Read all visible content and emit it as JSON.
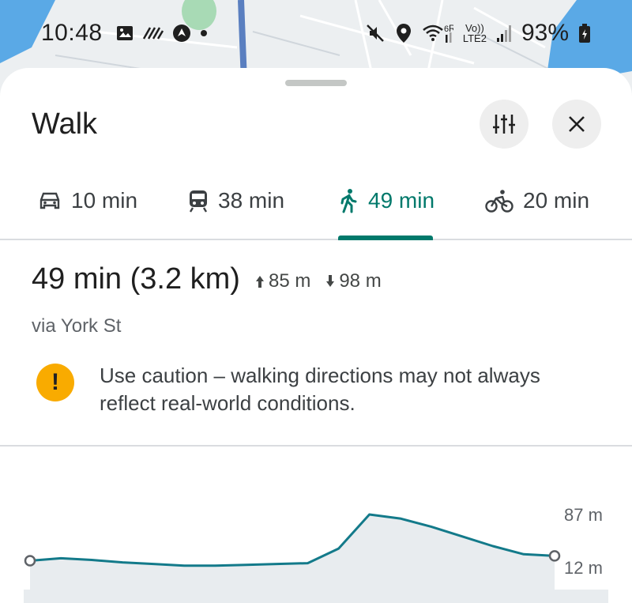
{
  "status_bar": {
    "time": "10:48",
    "battery": "93%",
    "left_icons": [
      "image-icon",
      "signal-waves-icon",
      "nav-arrow-icon",
      "dot-icon"
    ],
    "right_icons": [
      "mute-icon",
      "location-pin-icon",
      "wifi-icon",
      "volte-lte2-icon",
      "cell-signal-icon",
      "battery-charging-icon"
    ],
    "network_label_top": "Vo))",
    "network_label_bottom": "LTE2"
  },
  "sheet": {
    "title": "Walk",
    "options_icon": "tune-icon",
    "close_icon": "close-icon"
  },
  "tabs": [
    {
      "mode": "drive",
      "icon": "car-icon",
      "label": "10 min"
    },
    {
      "mode": "transit",
      "icon": "train-icon",
      "label": "38 min"
    },
    {
      "mode": "walk",
      "icon": "walk-icon",
      "label": "49 min",
      "active": true
    },
    {
      "mode": "bike",
      "icon": "bike-icon",
      "label": "20 min"
    }
  ],
  "route": {
    "summary": "49 min (3.2 km)",
    "ascent": "85 m",
    "descent": "98 m",
    "via": "via York St"
  },
  "warning": {
    "icon": "exclamation-icon",
    "symbol": "!",
    "text": "Use caution – walking directions may not always reflect real-world conditions."
  },
  "elevation": {
    "max_label": "87 m",
    "min_label": "12 m",
    "min_value": 12,
    "max_value": 87,
    "profile": [
      30,
      33,
      31,
      28,
      26,
      24,
      24,
      25,
      26,
      27,
      45,
      87,
      82,
      72,
      60,
      48,
      38,
      36
    ],
    "line_color": "#137a8a",
    "fill_color": "#e8ecef"
  },
  "colors": {
    "accent": "#00796b",
    "warning": "#f9ab00"
  }
}
